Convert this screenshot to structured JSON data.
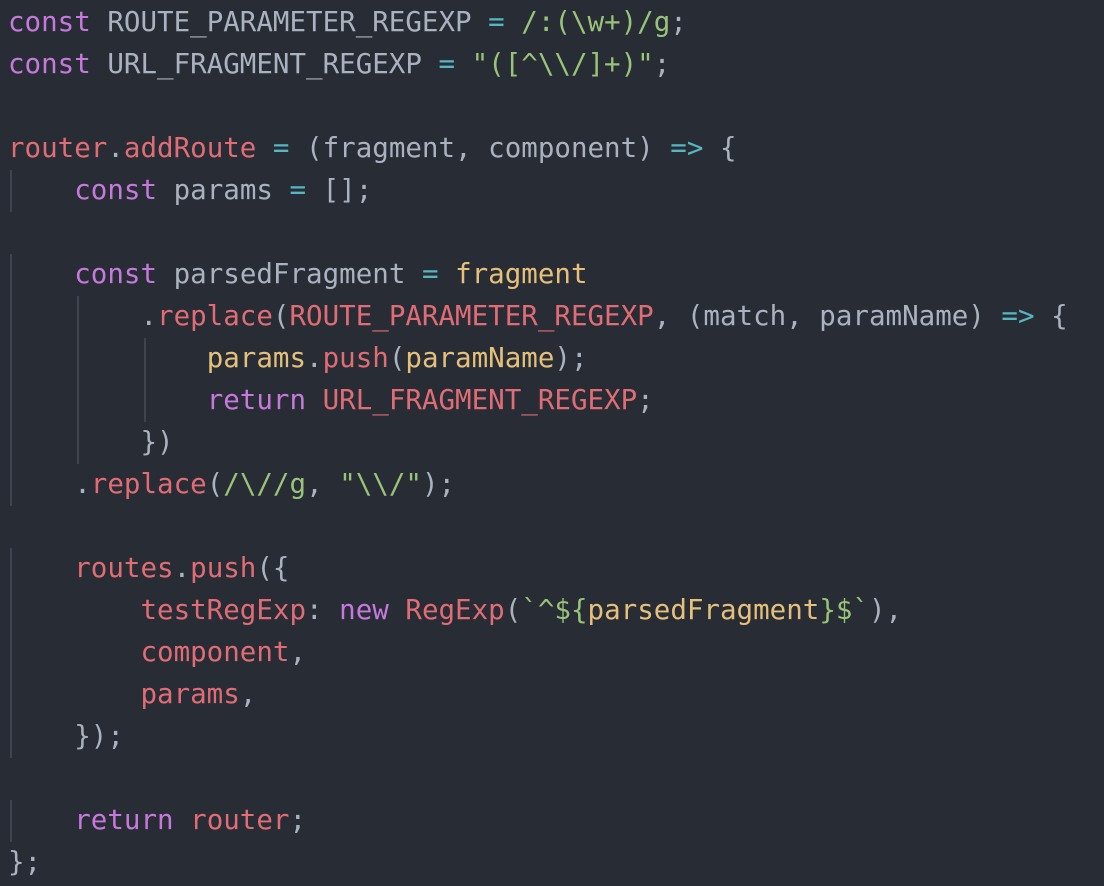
{
  "colors": {
    "background": "#282c34",
    "keyword": "#c678dd",
    "identifier": "#e06c75",
    "operator": "#56b6c2",
    "string": "#98c379",
    "variable": "#e5c07b",
    "plain": "#abb2bf",
    "indent_guide": "#3e4451"
  },
  "lines": [
    [
      {
        "c": "kw",
        "t": "const"
      },
      {
        "c": "pl",
        "t": " ROUTE_PARAMETER_REGEXP "
      },
      {
        "c": "op",
        "t": "="
      },
      {
        "c": "pl",
        "t": " "
      },
      {
        "c": "str",
        "t": "/:(\\w+)/g"
      },
      {
        "c": "pl",
        "t": ";"
      }
    ],
    [
      {
        "c": "kw",
        "t": "const"
      },
      {
        "c": "pl",
        "t": " URL_FRAGMENT_REGEXP "
      },
      {
        "c": "op",
        "t": "="
      },
      {
        "c": "pl",
        "t": " "
      },
      {
        "c": "str",
        "t": "\"([^\\\\/]+)\""
      },
      {
        "c": "pl",
        "t": ";"
      }
    ],
    [],
    [
      {
        "c": "id",
        "t": "router"
      },
      {
        "c": "pl",
        "t": "."
      },
      {
        "c": "fn",
        "t": "addRoute"
      },
      {
        "c": "pl",
        "t": " "
      },
      {
        "c": "op",
        "t": "="
      },
      {
        "c": "pl",
        "t": " (fragment, component) "
      },
      {
        "c": "op",
        "t": "=>"
      },
      {
        "c": "pl",
        "t": " {"
      }
    ],
    [
      {
        "c": "pl",
        "t": "    "
      },
      {
        "c": "kw",
        "t": "const"
      },
      {
        "c": "pl",
        "t": " params "
      },
      {
        "c": "op",
        "t": "="
      },
      {
        "c": "pl",
        "t": " [];"
      }
    ],
    [],
    [
      {
        "c": "pl",
        "t": "    "
      },
      {
        "c": "kw",
        "t": "const"
      },
      {
        "c": "pl",
        "t": " parsedFragment "
      },
      {
        "c": "op",
        "t": "="
      },
      {
        "c": "pl",
        "t": " "
      },
      {
        "c": "var",
        "t": "fragment"
      }
    ],
    [
      {
        "c": "pl",
        "t": "        ."
      },
      {
        "c": "fn",
        "t": "replace"
      },
      {
        "c": "pl",
        "t": "("
      },
      {
        "c": "id",
        "t": "ROUTE_PARAMETER_REGEXP"
      },
      {
        "c": "pl",
        "t": ", (match, paramName) "
      },
      {
        "c": "op",
        "t": "=>"
      },
      {
        "c": "pl",
        "t": " {"
      }
    ],
    [
      {
        "c": "pl",
        "t": "            "
      },
      {
        "c": "var",
        "t": "params"
      },
      {
        "c": "pl",
        "t": "."
      },
      {
        "c": "fn",
        "t": "push"
      },
      {
        "c": "pl",
        "t": "("
      },
      {
        "c": "var",
        "t": "paramName"
      },
      {
        "c": "pl",
        "t": ");"
      }
    ],
    [
      {
        "c": "pl",
        "t": "            "
      },
      {
        "c": "kw",
        "t": "return"
      },
      {
        "c": "pl",
        "t": " "
      },
      {
        "c": "id",
        "t": "URL_FRAGMENT_REGEXP"
      },
      {
        "c": "pl",
        "t": ";"
      }
    ],
    [
      {
        "c": "pl",
        "t": "        })"
      }
    ],
    [
      {
        "c": "pl",
        "t": "    ."
      },
      {
        "c": "fn",
        "t": "replace"
      },
      {
        "c": "pl",
        "t": "("
      },
      {
        "c": "str",
        "t": "/\\//g"
      },
      {
        "c": "pl",
        "t": ", "
      },
      {
        "c": "str",
        "t": "\"\\\\/\""
      },
      {
        "c": "pl",
        "t": ");"
      }
    ],
    [],
    [
      {
        "c": "pl",
        "t": "    "
      },
      {
        "c": "id",
        "t": "routes"
      },
      {
        "c": "pl",
        "t": "."
      },
      {
        "c": "fn",
        "t": "push"
      },
      {
        "c": "pl",
        "t": "({"
      }
    ],
    [
      {
        "c": "pl",
        "t": "        "
      },
      {
        "c": "id",
        "t": "testRegExp"
      },
      {
        "c": "pl",
        "t": ": "
      },
      {
        "c": "kw",
        "t": "new"
      },
      {
        "c": "pl",
        "t": " "
      },
      {
        "c": "id",
        "t": "RegExp"
      },
      {
        "c": "pl",
        "t": "("
      },
      {
        "c": "str",
        "t": "`^${"
      },
      {
        "c": "var",
        "t": "parsedFragment"
      },
      {
        "c": "str",
        "t": "}$`"
      },
      {
        "c": "pl",
        "t": "),"
      }
    ],
    [
      {
        "c": "pl",
        "t": "        "
      },
      {
        "c": "id",
        "t": "component"
      },
      {
        "c": "pl",
        "t": ","
      }
    ],
    [
      {
        "c": "pl",
        "t": "        "
      },
      {
        "c": "id",
        "t": "params"
      },
      {
        "c": "pl",
        "t": ","
      }
    ],
    [
      {
        "c": "pl",
        "t": "    });"
      }
    ],
    [],
    [
      {
        "c": "pl",
        "t": "    "
      },
      {
        "c": "kw",
        "t": "return"
      },
      {
        "c": "pl",
        "t": " "
      },
      {
        "c": "id",
        "t": "router"
      },
      {
        "c": "pl",
        "t": ";"
      }
    ],
    [
      {
        "c": "pl",
        "t": "};"
      }
    ]
  ]
}
